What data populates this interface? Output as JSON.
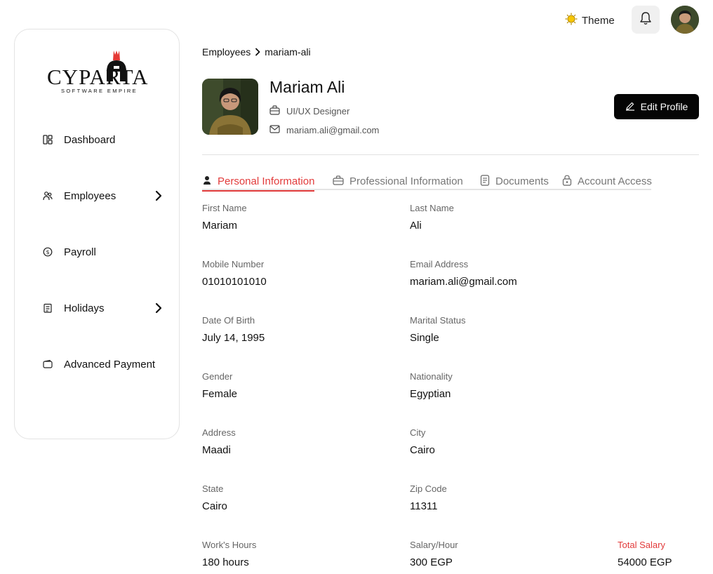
{
  "header": {
    "theme_label": "Theme",
    "icons": {
      "theme": "sun-icon",
      "notifications": "bell-icon",
      "user": "user-avatar"
    }
  },
  "sidebar": {
    "logo": {
      "wordmark": "CYPARTA",
      "tagline": "SOFTWARE EMPIRE"
    },
    "items": [
      {
        "label": "Dashboard",
        "icon": "dashboard-icon",
        "expandable": false
      },
      {
        "label": "Employees",
        "icon": "employees-icon",
        "expandable": true
      },
      {
        "label": "Payroll",
        "icon": "dollar-icon",
        "expandable": false
      },
      {
        "label": "Holidays",
        "icon": "calendar-icon",
        "expandable": true
      },
      {
        "label": "Advanced Payment",
        "icon": "wallet-icon",
        "expandable": false
      }
    ]
  },
  "breadcrumb": {
    "parent": "Employees",
    "current": "mariam-ali"
  },
  "profile": {
    "name": "Mariam Ali",
    "role": "UI/UX Designer",
    "email": "mariam.ali@gmail.com",
    "edit_label": "Edit Profile"
  },
  "tabs": [
    {
      "label": "Personal Information",
      "icon": "person-icon",
      "active": true
    },
    {
      "label": "Professional Information",
      "icon": "briefcase-icon",
      "active": false
    },
    {
      "label": "Documents",
      "icon": "document-icon",
      "active": false
    },
    {
      "label": "Account Access",
      "icon": "lock-icon",
      "active": false
    }
  ],
  "fields": [
    {
      "label": "First Name",
      "value": "Mariam"
    },
    {
      "label": "Last Name",
      "value": "Ali"
    },
    {
      "label": "Mobile Number",
      "value": "01010101010"
    },
    {
      "label": "Email Address",
      "value": "mariam.ali@gmail.com"
    },
    {
      "label": "Date Of Birth",
      "value": "July 14, 1995"
    },
    {
      "label": "Marital Status",
      "value": "Single"
    },
    {
      "label": "Gender",
      "value": "Female"
    },
    {
      "label": "Nationality",
      "value": "Egyptian"
    },
    {
      "label": "Address",
      "value": "Maadi"
    },
    {
      "label": "City",
      "value": "Cairo"
    },
    {
      "label": "State",
      "value": "Cairo"
    },
    {
      "label": "Zip Code",
      "value": "11311"
    },
    {
      "label": "Work's Hours",
      "value": "180 hours"
    },
    {
      "label": "Salary/Hour",
      "value": "300 EGP"
    },
    {
      "label": "Total Salary",
      "value": "54000 EGP"
    }
  ],
  "colors": {
    "accent": "#e23b3b",
    "button": "#050505",
    "border": "#e3e3e3"
  }
}
